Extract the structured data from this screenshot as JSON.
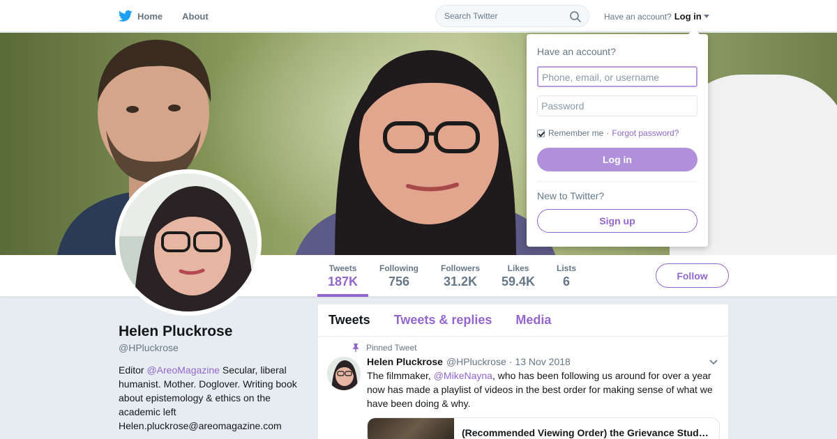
{
  "nav": {
    "home_label": "Home",
    "about_label": "About",
    "search_placeholder": "Search Twitter",
    "have_account_text": "Have an account?",
    "login_label": "Log in"
  },
  "login_dropdown": {
    "title": "Have an account?",
    "username_placeholder": "Phone, email, or username",
    "password_placeholder": "Password",
    "remember_label": "Remember me",
    "separator": "·",
    "forgot_label": "Forgot password?",
    "login_button": "Log in",
    "new_text": "New to Twitter?",
    "signup_button": "Sign up"
  },
  "stats": [
    {
      "label": "Tweets",
      "value": "187K"
    },
    {
      "label": "Following",
      "value": "756"
    },
    {
      "label": "Followers",
      "value": "31.2K"
    },
    {
      "label": "Likes",
      "value": "59.4K"
    },
    {
      "label": "Lists",
      "value": "6"
    }
  ],
  "follow_label": "Follow",
  "profile": {
    "name": "Helen Pluckrose",
    "handle": "@HPluckrose",
    "bio_prefix": "Editor ",
    "bio_mention": "@AreoMagazine",
    "bio_rest": " Secular, liberal humanist. Mother. Doglover. Writing book about epistemology & ethics on the academic left",
    "bio_email": "Helen.pluckrose@areomagazine.com"
  },
  "timeline": {
    "tabs": [
      "Tweets",
      "Tweets & replies",
      "Media"
    ],
    "pinned_label": "Pinned Tweet",
    "tweet": {
      "author": "Helen Pluckrose",
      "handle": "@HPluckrose",
      "dot": "·",
      "date": "13 Nov 2018",
      "text_prefix": "The filmmaker, ",
      "mention": "@MikeNayna",
      "text_rest": ", who has been following us around for over a year now has made a playlist of videos in the best order for making sense of what we have been doing & why.",
      "card_title": "(Recommended Viewing Order) the Grievance Stud…"
    }
  },
  "colors": {
    "accent": "#9266cc",
    "twitter_blue": "#1da1f2"
  }
}
